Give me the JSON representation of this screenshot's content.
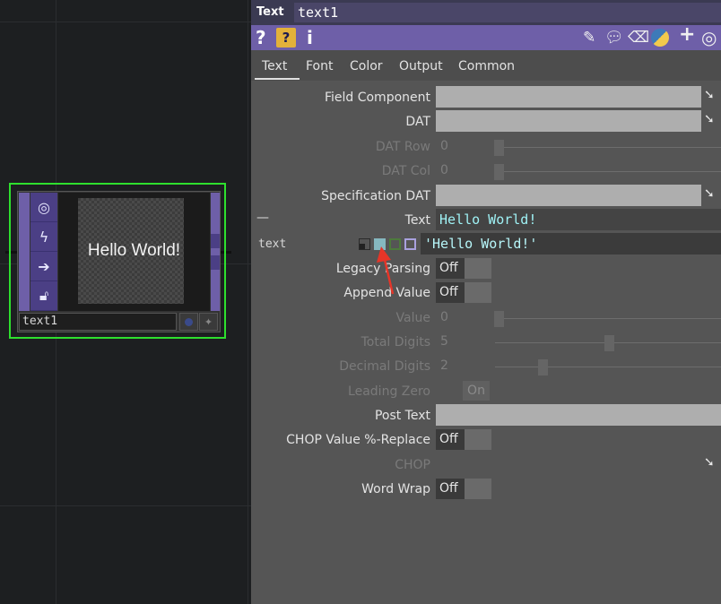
{
  "node": {
    "display_text": "Hello World!",
    "name": "text1",
    "icons": [
      "target-icon",
      "bolt-icon",
      "arrow-right-icon",
      "lock-open-icon"
    ]
  },
  "panel": {
    "op_type": "Text",
    "op_name": "text1",
    "toolbar": {
      "help": "?",
      "help_python": "?",
      "info": "i",
      "right_icons": [
        "pencil-icon",
        "comment-icon",
        "eraser-icon",
        "python-icon",
        "plus-icon",
        "viewer-icon"
      ]
    },
    "tabs": [
      {
        "label": "Text",
        "active": true
      },
      {
        "label": "Font",
        "active": false
      },
      {
        "label": "Color",
        "active": false
      },
      {
        "label": "Output",
        "active": false
      },
      {
        "label": "Common",
        "active": false
      }
    ],
    "params": {
      "field_component": "Field Component",
      "dat": "DAT",
      "dat_row": {
        "label": "DAT Row",
        "value": "0"
      },
      "dat_col": {
        "label": "DAT Col",
        "value": "0"
      },
      "spec_dat": "Specification DAT",
      "text": {
        "label": "Text",
        "value": "Hello World!",
        "collapse": "—"
      },
      "text_expr": {
        "name": "text",
        "value": "'Hello World!'"
      },
      "legacy_parsing": {
        "label": "Legacy Parsing",
        "value": "Off"
      },
      "append_value": {
        "label": "Append Value",
        "value": "Off"
      },
      "value": {
        "label": "Value",
        "value": "0"
      },
      "total_digits": {
        "label": "Total Digits",
        "value": "5"
      },
      "decimal_digits": {
        "label": "Decimal Digits",
        "value": "2"
      },
      "leading_zero": {
        "label": "Leading Zero",
        "value": "On"
      },
      "post_text": {
        "label": "Post Text",
        "value": ""
      },
      "chop_replace": {
        "label": "CHOP Value %-Replace",
        "value": "Off"
      },
      "chop": {
        "label": "CHOP"
      },
      "word_wrap": {
        "label": "Word Wrap",
        "value": "Off"
      }
    }
  },
  "colors": {
    "selection": "#2ee02e",
    "toolbar": "#6e5fa8",
    "annotation_arrow": "#e63528"
  }
}
